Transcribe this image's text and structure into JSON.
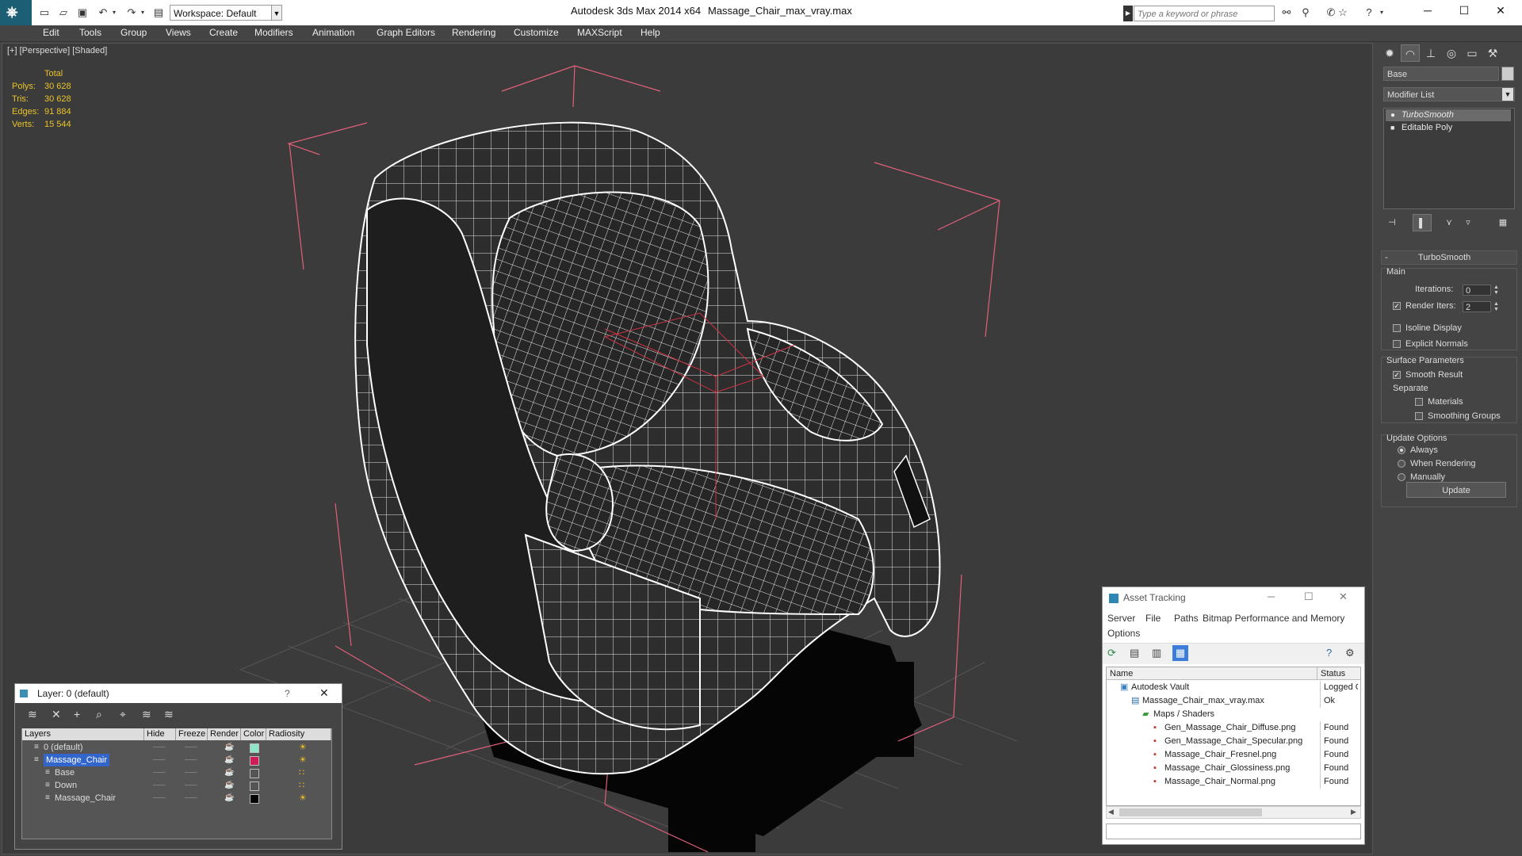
{
  "titlebar": {
    "workspace": "Workspace: Default",
    "app_title": "Autodesk 3ds Max  2014 x64",
    "file_title": "Massage_Chair_max_vray.max",
    "search_placeholder": "Type a keyword or phrase"
  },
  "menu": [
    "Edit",
    "Tools",
    "Group",
    "Views",
    "Create",
    "Modifiers",
    "Animation",
    "Graph Editors",
    "Rendering",
    "Customize",
    "MAXScript",
    "Help"
  ],
  "viewport": {
    "label": "[+] [Perspective] [Shaded]",
    "stats": {
      "header": "Total",
      "rows": [
        {
          "label": "Polys:",
          "value": "30 628"
        },
        {
          "label": "Tris:",
          "value": "30 628"
        },
        {
          "label": "Edges:",
          "value": "91 884"
        },
        {
          "label": "Verts:",
          "value": "15 544"
        }
      ]
    }
  },
  "command_panel": {
    "object_name": "Base",
    "modifier_list": "Modifier List",
    "stack": [
      "TurboSmooth",
      "Editable Poly"
    ],
    "rollout_title": "TurboSmooth",
    "main_group": "Main",
    "iterations_label": "Iterations:",
    "iterations_value": "0",
    "render_iters_label": "Render Iters:",
    "render_iters_value": "2",
    "isoline_label": "Isoline Display",
    "explicit_normals_label": "Explicit Normals",
    "surface_group": "Surface Parameters",
    "smooth_result_label": "Smooth Result",
    "separate_label": "Separate",
    "materials_label": "Materials",
    "smoothing_groups_label": "Smoothing Groups",
    "update_group": "Update Options",
    "always_label": "Always",
    "when_rendering_label": "When Rendering",
    "manually_label": "Manually",
    "update_button": "Update"
  },
  "layer_dialog": {
    "title": "Layer: 0 (default)",
    "help": "?",
    "columns": [
      "Layers",
      "Hide",
      "Freeze",
      "Render",
      "Color",
      "Radiosity"
    ],
    "rows": [
      {
        "name": "0 (default)",
        "color": "#8fe3c8",
        "indent": 1,
        "selected": false
      },
      {
        "name": "Massage_Chair",
        "color": "#cc1d5a",
        "indent": 1,
        "selected": true
      },
      {
        "name": "Base",
        "color": "#555555",
        "indent": 2,
        "selected": false
      },
      {
        "name": "Down",
        "color": "#555555",
        "indent": 2,
        "selected": false
      },
      {
        "name": "Massage_Chair",
        "color": "#000000",
        "indent": 2,
        "selected": false
      }
    ]
  },
  "asset_dialog": {
    "title": "Asset Tracking",
    "menu": [
      "Server",
      "File",
      "Paths",
      "Bitmap Performance and Memory",
      "Options"
    ],
    "columns": [
      "Name",
      "Status"
    ],
    "rows": [
      {
        "name": "Autodesk Vault",
        "status": "Logged O",
        "indent": 1
      },
      {
        "name": "Massage_Chair_max_vray.max",
        "status": "Ok",
        "indent": 2
      },
      {
        "name": "Maps / Shaders",
        "status": "",
        "indent": 3
      },
      {
        "name": "Gen_Massage_Chair_Diffuse.png",
        "status": "Found",
        "indent": 4
      },
      {
        "name": "Gen_Massage_Chair_Specular.png",
        "status": "Found",
        "indent": 4
      },
      {
        "name": "Massage_Chair_Fresnel.png",
        "status": "Found",
        "indent": 4
      },
      {
        "name": "Massage_Chair_Glossiness.png",
        "status": "Found",
        "indent": 4
      },
      {
        "name": "Massage_Chair_Normal.png",
        "status": "Found",
        "indent": 4
      }
    ]
  },
  "colors": {
    "accent": "#1c5e74",
    "stat_text": "#eac229",
    "bbox": "#e0607a",
    "selection": "#3366cc"
  }
}
